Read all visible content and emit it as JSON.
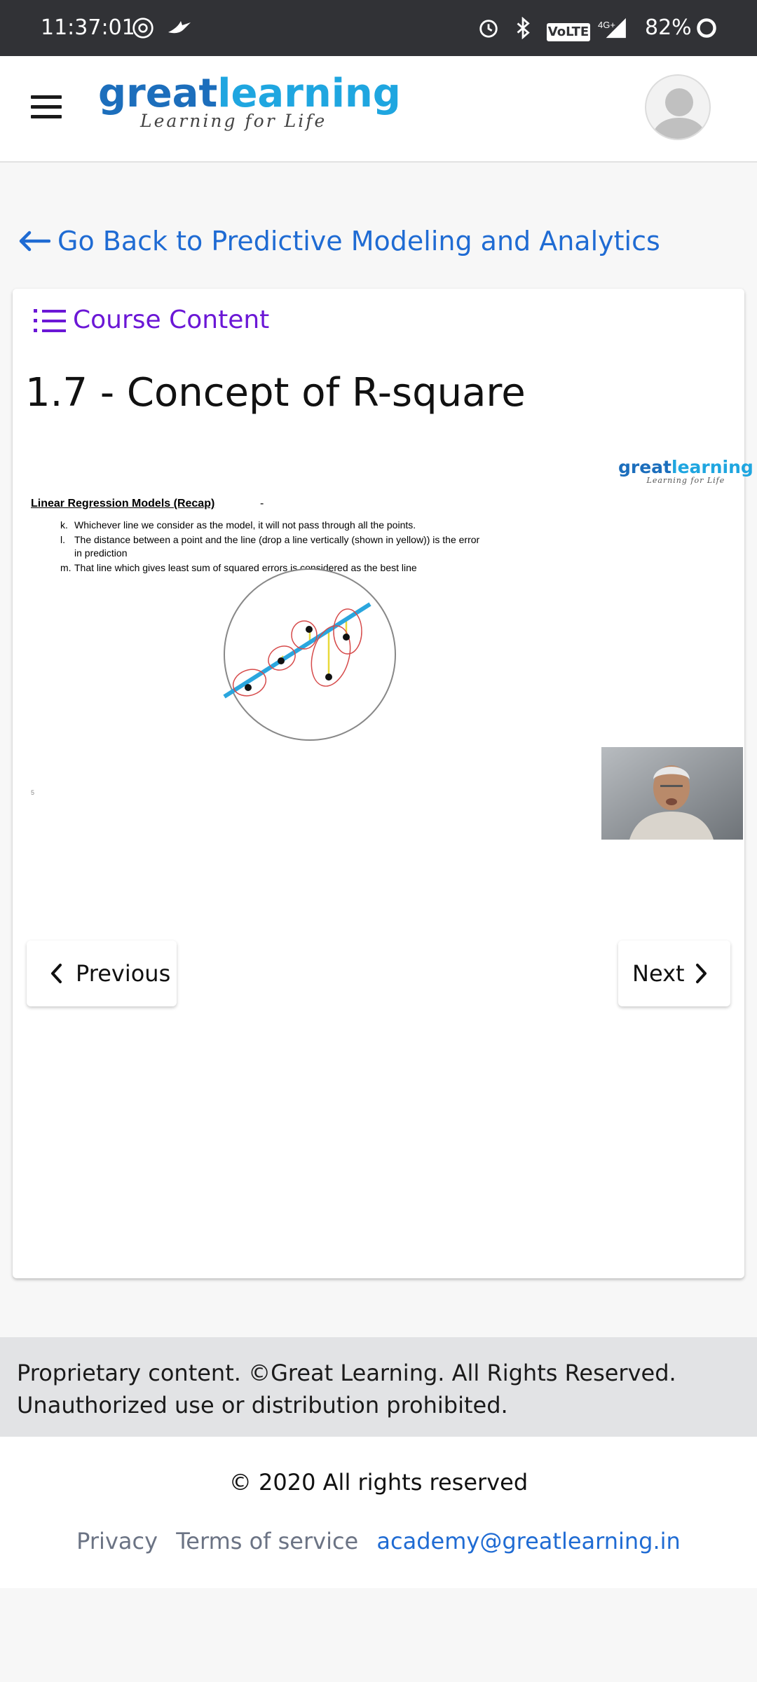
{
  "status_bar": {
    "time": "11:37:01",
    "network_badge": "VoLTE",
    "network_type": "4G+",
    "battery": "82%"
  },
  "header": {
    "logo": {
      "part1": "great",
      "part2": "learning",
      "tagline": "Learning for Life"
    },
    "icons": [
      "menu-icon",
      "avatar"
    ]
  },
  "back_link": {
    "label": "Go Back to Predictive Modeling and Analytics"
  },
  "course_content": {
    "label": "Course Content"
  },
  "lesson": {
    "title": "1.7 - Concept of R-square",
    "slide": {
      "logo_part1": "great",
      "logo_part2": "learning",
      "logo_tagline": "Learning for Life",
      "heading": "Linear Regression Models (Recap)",
      "dash": "-",
      "items": [
        {
          "marker": "k.",
          "text": "Whichever line we consider as the model, it will not pass through all the points."
        },
        {
          "marker": "l.",
          "text": "The distance between a point and the line (drop a line vertically (shown in yellow)) is the error in prediction"
        },
        {
          "marker": "m.",
          "text": "That line which gives least sum of squared errors is considered as the best line"
        }
      ],
      "page_number": "5"
    }
  },
  "navigation": {
    "previous": "Previous",
    "next": "Next"
  },
  "notice": {
    "line1": "Proprietary content. ©Great Learning. All Rights Reserved.",
    "line2": "Unauthorized use or distribution prohibited."
  },
  "footer": {
    "copyright": "© 2020 All rights reserved",
    "privacy": "Privacy",
    "terms": "Terms of service",
    "email": "academy@greatlearning.in"
  },
  "colors": {
    "brand_dark_blue": "#1c6ebc",
    "brand_light_blue": "#1fa6e0",
    "link_blue": "#1f6bd3",
    "course_purple": "#6b17d6",
    "status_bar": "#313236"
  }
}
